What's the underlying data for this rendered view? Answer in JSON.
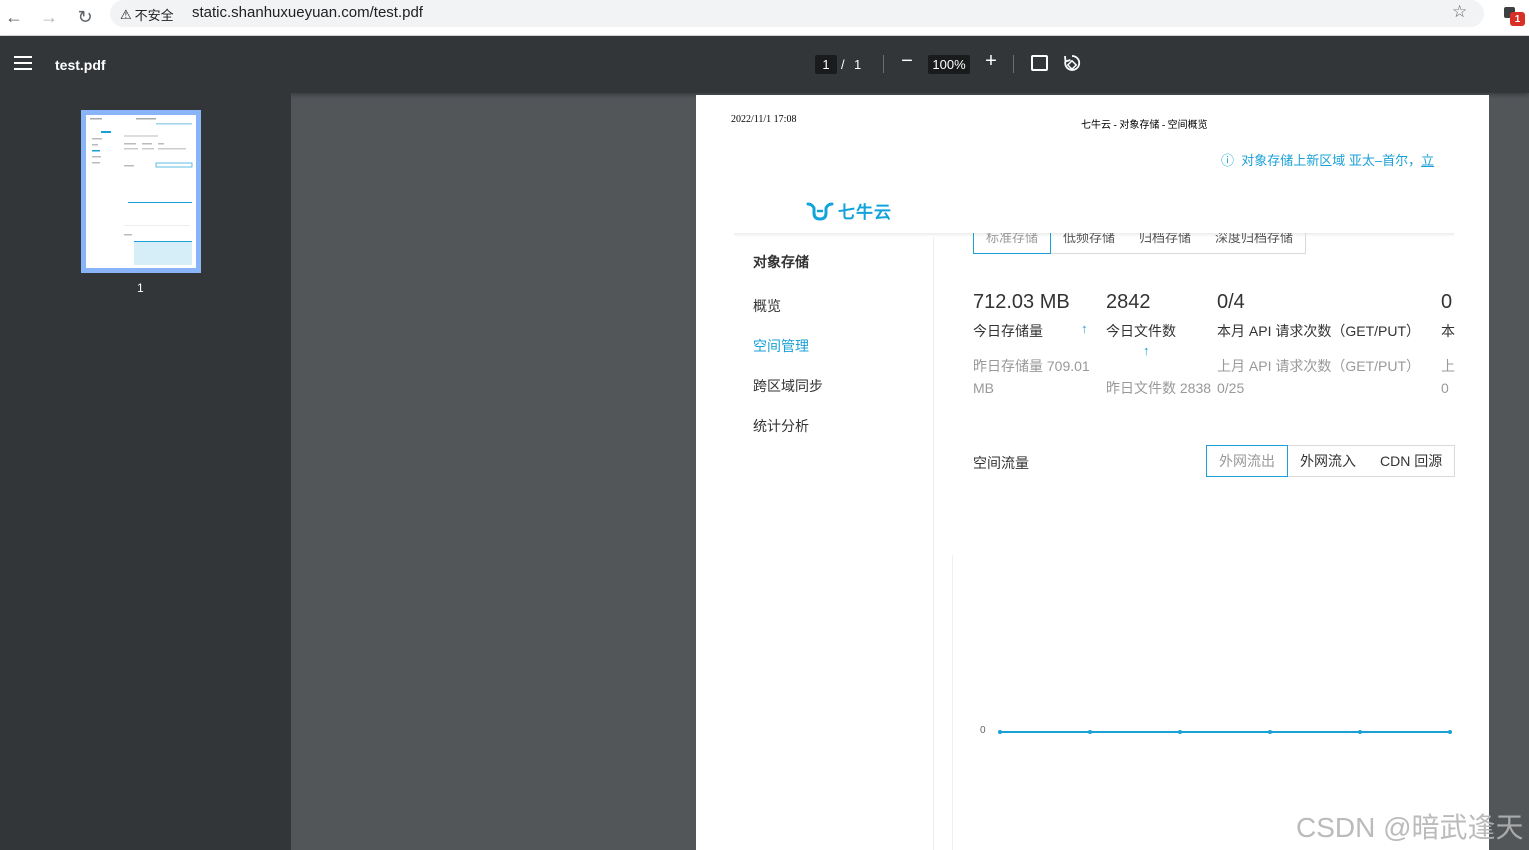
{
  "browser": {
    "security_warning": "不安全",
    "url": "static.shanhuxueyuan.com/test.pdf",
    "extension_badge": "1"
  },
  "pdf_toolbar": {
    "file_name": "test.pdf",
    "current_page": "1",
    "separator": "/",
    "total_pages": "1",
    "zoom": "100%"
  },
  "thumbnails": {
    "items": [
      {
        "label": "1"
      }
    ]
  },
  "page": {
    "print_date": "2022/11/1 17:08",
    "print_title": "七牛云 - 对象存储 - 空间概览",
    "notice": "对象存储上新区域 亚太–首尔，",
    "notice_link": "立",
    "logo_text": "七牛云",
    "nav": {
      "title": "对象存储",
      "items": [
        {
          "label": "概览",
          "active": false
        },
        {
          "label": "空间管理",
          "active": true
        },
        {
          "label": "跨区域同步",
          "active": false
        },
        {
          "label": "统计分析",
          "active": false
        }
      ]
    },
    "storage_tabs": [
      "标准存储",
      "低频存储",
      "归档存储",
      "深度归档存储"
    ],
    "stats": [
      {
        "value": "712.03 MB",
        "label": "今日存储量",
        "sub1": "昨日存储量 709.01",
        "sub2": "MB"
      },
      {
        "value": "2842",
        "label": "今日文件数",
        "sub1": "",
        "sub2": "昨日文件数 2838"
      },
      {
        "value": "0/4",
        "label": "本月 API 请求次数（GET/PUT）",
        "sub1": "上月 API 请求次数（GET/PUT）",
        "sub2": "0/25"
      },
      {
        "value": "0",
        "label": "本",
        "sub1": "上",
        "sub2": "0"
      }
    ],
    "traffic": {
      "title": "空间流量",
      "tabs": [
        "外网流出",
        "外网流入",
        "CDN 回源"
      ],
      "y_axis_label": "0"
    }
  },
  "chart_data": {
    "type": "line",
    "x": [
      1,
      2,
      3,
      4,
      5,
      6
    ],
    "series": [
      {
        "values": [
          0,
          0,
          0,
          0,
          0,
          0
        ]
      }
    ],
    "yticks": [
      "0"
    ],
    "color": "#1aa1d6"
  },
  "watermark": "CSDN @暗武逢天",
  "colors": {
    "accent": "#1aa1d6",
    "toolbar": "#323639",
    "viewer_bg": "#525659"
  }
}
